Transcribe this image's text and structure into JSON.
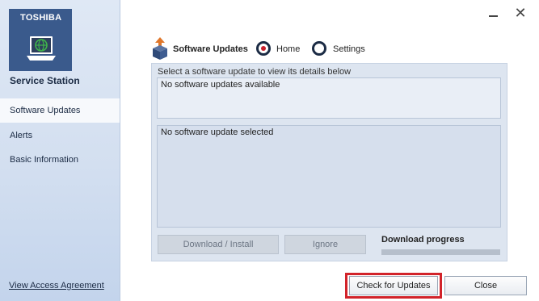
{
  "sidebar": {
    "brand": "TOSHIBA",
    "app_name": "Service Station",
    "items": [
      {
        "label": "Software Updates",
        "active": true
      },
      {
        "label": "Alerts",
        "active": false
      },
      {
        "label": "Basic Information",
        "active": false
      }
    ],
    "footer_link": "View Access Agreement"
  },
  "window": {
    "minimize_icon": "minimize-icon",
    "close_icon": "close-icon",
    "close_glyph": "✕"
  },
  "header": {
    "title": "Software Updates",
    "options": [
      {
        "label": "Home",
        "selected": true
      },
      {
        "label": "Settings",
        "selected": false
      }
    ]
  },
  "main": {
    "instruction": "Select a software update to view its details below",
    "list_text": "No software updates available",
    "details_text": "No software update selected",
    "download_label": "Download / Install",
    "ignore_label": "Ignore",
    "progress_label": "Download progress",
    "progress": 0
  },
  "footer": {
    "check_label": "Check for Updates",
    "close_label": "Close"
  },
  "colors": {
    "accent_red": "#d2232a",
    "navy": "#1b2b44",
    "logo_tile": "#3a5a8c"
  }
}
